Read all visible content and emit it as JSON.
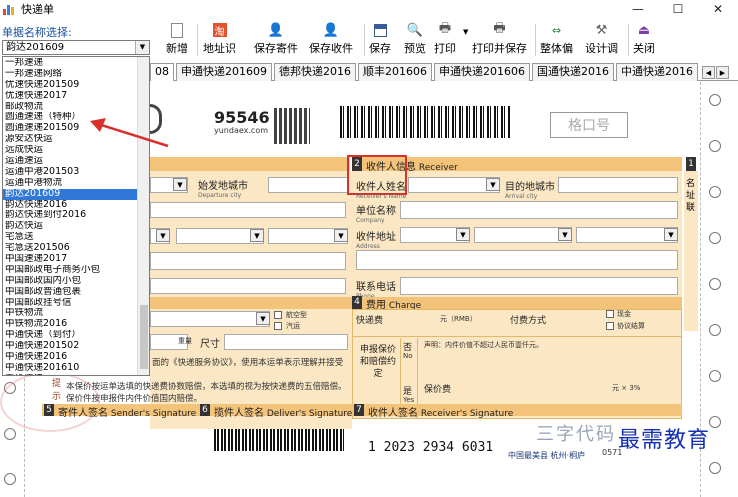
{
  "window": {
    "title": "快递单",
    "minimize": "—",
    "maximize": "☐",
    "close": "✕"
  },
  "toolbar": {
    "select_label": "单据名称选择:",
    "selected_value": "韵达201609",
    "buttons": [
      {
        "label": "新增",
        "icon": "new-doc-icon"
      },
      {
        "label": "地址识",
        "icon": "address-icon"
      },
      {
        "label": "保存寄件",
        "icon": "save-sender-icon"
      },
      {
        "label": "保存收件",
        "icon": "save-receiver-icon"
      },
      {
        "label": "保存",
        "icon": "save-icon"
      },
      {
        "label": "预览",
        "icon": "preview-icon"
      },
      {
        "label": "打印",
        "icon": "print-icon"
      },
      {
        "label": "打印并保存",
        "icon": "print-save-icon"
      },
      {
        "label": "整体偏",
        "icon": "offset-icon"
      },
      {
        "label": "设计调",
        "icon": "design-icon"
      },
      {
        "label": "关闭",
        "icon": "exit-icon"
      }
    ]
  },
  "tabs": [
    "08",
    "申通快递201609",
    "德邦快递2016",
    "顺丰201606",
    "申通快递201606",
    "国通快递2016",
    "中通快递2016"
  ],
  "dropdown": {
    "items": [
      "一邦速递",
      "一邦速递网络",
      "优速快递201509",
      "优速快递2017",
      "邮政物流",
      "圆通速递（特种）",
      "圆通速递201509",
      "源安达快运",
      "远成快运",
      "运通速运",
      "运通中港201503",
      "运通中港物流",
      "韵达201609",
      "韵达快递2016",
      "韵达快递到付2016",
      "韵达快运",
      "宅急送",
      "宅急送201506",
      "中国速递2017",
      "中国邮政电子商务小包",
      "中国邮政国内小包",
      "中国邮政普通包裹",
      "中国邮政挂号信",
      "中铁物流",
      "中铁物流2016",
      "中通快递（到付）",
      "中通快递201502",
      "中通快递2016",
      "中通快递201610",
      "中通速递"
    ],
    "selected_index": 12
  },
  "waybill": {
    "logo_number": "95546",
    "logo_domain": "yundaex.com",
    "grid_box": "格口号",
    "section2": {
      "num": "2",
      "title": "收件人信息",
      "en": "Receiver"
    },
    "recipient_name": "收件人姓名",
    "recipient_name_en": "Receiver's Name",
    "dest_city": "目的地城市",
    "dest_city_en": "Arrival city",
    "origin_city": "始发地城市",
    "origin_city_en": "Departure city",
    "company": "单位名称",
    "company_en": "Company",
    "address": "收件地址",
    "address_en": "Address",
    "phone": "联系电话",
    "phone_en": "Phone",
    "side_label": "名址联",
    "section4": {
      "num": "4",
      "title": "费用",
      "en": "Charge"
    },
    "express_fee": "快递费",
    "express_fee_unit": "元（RMB）",
    "pay_method": "付费方式",
    "cash": "现金",
    "monthly": "协议结算",
    "insure": "申报保价和赔偿约定",
    "insure_no": "否",
    "insure_yes": "是",
    "insure_no_en": "No",
    "insure_yes_en": "Yes",
    "declare_text": "声明：内件价值不超过人民币壹仟元。",
    "insure_fee": "保价费",
    "declared_value": "元 × 3%",
    "aviation": "航空型",
    "land": "汽运",
    "size": "尺寸",
    "weight": "重量",
    "tips": "提示",
    "agreement": "面的《快递服务协议》，使用本运单表示理解并接受",
    "tips_text1": "本保价按运单选填的快递费协数赔偿，本选填的视为按快递费的五倍赔偿。",
    "tips_text2": "保价件按申报件内件价值国内赔偿。",
    "section5": {
      "num": "5",
      "title": "寄件人签名",
      "en": "Sender's Signature"
    },
    "section6": {
      "num": "6",
      "title": "揽件人签名",
      "en": "Deliver's Signature"
    },
    "section7": {
      "num": "7",
      "title": "收件人签名",
      "en": "Receiver's Signature"
    },
    "tracking_number": "1 2023 2934 6031",
    "code3": "三字代码",
    "dest_label": "中国最美县 杭州·桐庐",
    "dest_phone": "0571",
    "watermark": "最需教育"
  },
  "colors": {
    "accent": "#3078d8",
    "label_blue": "#1a4fa0",
    "highlight_red": "#d9302c",
    "orange_band": "#f4c37a",
    "form_fill": "#fbe7c4"
  }
}
